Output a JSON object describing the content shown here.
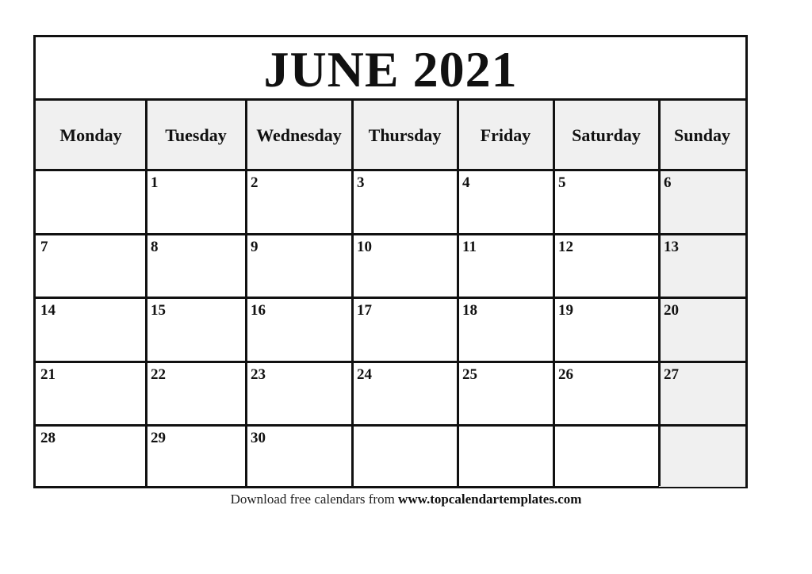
{
  "calendar": {
    "title": "JUNE 2021",
    "weekdays": [
      "Monday",
      "Tuesday",
      "Wednesday",
      "Thursday",
      "Friday",
      "Saturday",
      "Sunday"
    ],
    "weeks": [
      [
        "",
        "1",
        "2",
        "3",
        "4",
        "5",
        "6"
      ],
      [
        "7",
        "8",
        "9",
        "10",
        "11",
        "12",
        "13"
      ],
      [
        "14",
        "15",
        "16",
        "17",
        "18",
        "19",
        "20"
      ],
      [
        "21",
        "22",
        "23",
        "24",
        "25",
        "26",
        "27"
      ],
      [
        "28",
        "29",
        "30",
        "",
        "",
        "",
        ""
      ]
    ],
    "colors": {
      "grid_line": "#111111",
      "header_fill": "#f0f0f0",
      "sunday_fill": "#f0f0f0"
    }
  },
  "footer": {
    "text": "Download free calendars from ",
    "link": "www.topcalendartemplates.com"
  }
}
